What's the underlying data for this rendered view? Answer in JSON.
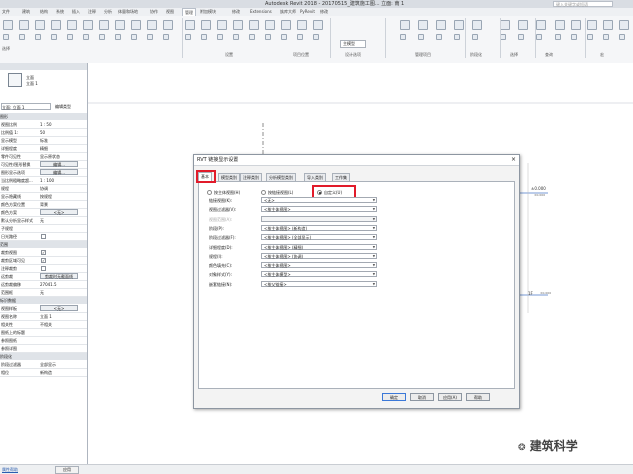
{
  "titlebar": {
    "title": "Autodesk Revit 2018 - 20170515_建筑施工图... 立面: 南 1",
    "search_placeholder": "键入关键字或短语"
  },
  "menu": {
    "tabs": [
      "文件",
      "建筑",
      "结构",
      "系统",
      "插入",
      "注释",
      "分析",
      "体量和场地",
      "协作",
      "视图",
      "管理",
      "附加模块",
      "修改",
      "Extensions",
      "族库大师",
      "PyRevit",
      "修改"
    ],
    "active_index": 10
  },
  "ribbon": {
    "panels": [
      "设置",
      "项目位置",
      "设计选项",
      "管理项目",
      "阶段化",
      "选择",
      "查询",
      "宏"
    ],
    "select_label": "选择",
    "design_option_label": "主模型"
  },
  "properties": {
    "type_icon_label": "立面",
    "type_icon_sub": "立面 1",
    "type_selector": "立面: 立面 1",
    "edit_type": "编辑类型",
    "rows": [
      {
        "kind": "section",
        "name": "图形"
      },
      {
        "name": "视图比例",
        "value": "1 : 50"
      },
      {
        "name": "比例值 1:",
        "value": "50"
      },
      {
        "name": "显示模型",
        "value": "标准"
      },
      {
        "name": "详细程度",
        "value": "精细"
      },
      {
        "name": "零件可见性",
        "value": "显示原状态"
      },
      {
        "name": "可见性/图形替换",
        "value": "编辑...",
        "button": true
      },
      {
        "name": "图形显示选项",
        "value": "编辑...",
        "button": true
      },
      {
        "name": "当比例粗略度超...",
        "value": "1 : 100"
      },
      {
        "name": "规程",
        "value": "协调"
      },
      {
        "name": "显示隐藏线",
        "value": "按规程"
      },
      {
        "name": "颜色方案位置",
        "value": "背景"
      },
      {
        "name": "颜色方案",
        "value": "<无>",
        "button": true
      },
      {
        "name": "默认分析显示样式",
        "value": "无"
      },
      {
        "name": "子规程",
        "value": ""
      },
      {
        "name": "日光路径",
        "value": "",
        "check": false
      },
      {
        "kind": "section",
        "name": "范围"
      },
      {
        "name": "裁剪视图",
        "value": "",
        "check": true
      },
      {
        "name": "裁剪区域可见",
        "value": "",
        "check": true
      },
      {
        "name": "注释裁剪",
        "value": "",
        "check": false
      },
      {
        "name": "远剪裁",
        "value": "剪裁时无截面线",
        "button": true
      },
      {
        "name": "远剪裁偏移",
        "value": "27041.5"
      },
      {
        "name": "范围框",
        "value": "无"
      },
      {
        "kind": "section",
        "name": "标识数据"
      },
      {
        "name": "视图样板",
        "value": "<无>",
        "button": true
      },
      {
        "name": "视图名称",
        "value": "立面 1"
      },
      {
        "name": "相关性",
        "value": "不相关"
      },
      {
        "name": "图纸上的标题",
        "value": ""
      },
      {
        "name": "参照图纸",
        "value": ""
      },
      {
        "name": "参照详图",
        "value": ""
      },
      {
        "kind": "section",
        "name": "阶段化"
      },
      {
        "name": "阶段过滤器",
        "value": "全部显示"
      },
      {
        "name": "相位",
        "value": "新构造"
      }
    ]
  },
  "status": {
    "help_link": "属性帮助",
    "apply": "应用"
  },
  "canvas": {
    "level_top_value": "±0.000",
    "level_top_sub": "±0.000",
    "level_mid_value": "1F",
    "level_mid_sub": "±0.000"
  },
  "dialog": {
    "title": "RVT 链接显示设置",
    "tabs": [
      "基本",
      "模型类别",
      "注释类别",
      "分析模型类别",
      "导入类别",
      "工作集"
    ],
    "active_tab": 0,
    "radios": [
      {
        "label": "按主体视图(H)",
        "checked": false
      },
      {
        "label": "按链接视图(L)",
        "checked": false
      },
      {
        "label": "自定义(U)",
        "checked": true
      }
    ],
    "fields": [
      {
        "label": "链接视图(K):",
        "value": "<无>",
        "disabled": false
      },
      {
        "label": "视图过滤器(V):",
        "value": "<按主体视图>",
        "disabled": false
      },
      {
        "label": "视图范围(A):",
        "value": "",
        "disabled": true
      },
      {
        "label": "阶段(P):",
        "value": "<按主体视图> (新构造)",
        "disabled": false
      },
      {
        "label": "阶段过滤器(F):",
        "value": "<按主体视图> (全部显示)",
        "disabled": false
      },
      {
        "label": "详细程度(D):",
        "value": "<按主体视图> (精细)",
        "disabled": false
      },
      {
        "label": "规程(I):",
        "value": "<按主体视图> (协调)",
        "disabled": false
      },
      {
        "label": "颜色填充(C):",
        "value": "<按主体视图>",
        "disabled": false
      },
      {
        "label": "对象样式(Y):",
        "value": "<按主体模型>",
        "disabled": false
      },
      {
        "label": "嵌套链接(N):",
        "value": "<按父链接>",
        "disabled": false
      }
    ],
    "buttons": [
      "确定",
      "取消",
      "应用(A)",
      "帮助"
    ]
  },
  "watermark": "建筑科学",
  "colors": {
    "highlight": "#e11b2a",
    "titlebar": "#d9dde3",
    "ok_border": "#3b78d8"
  }
}
